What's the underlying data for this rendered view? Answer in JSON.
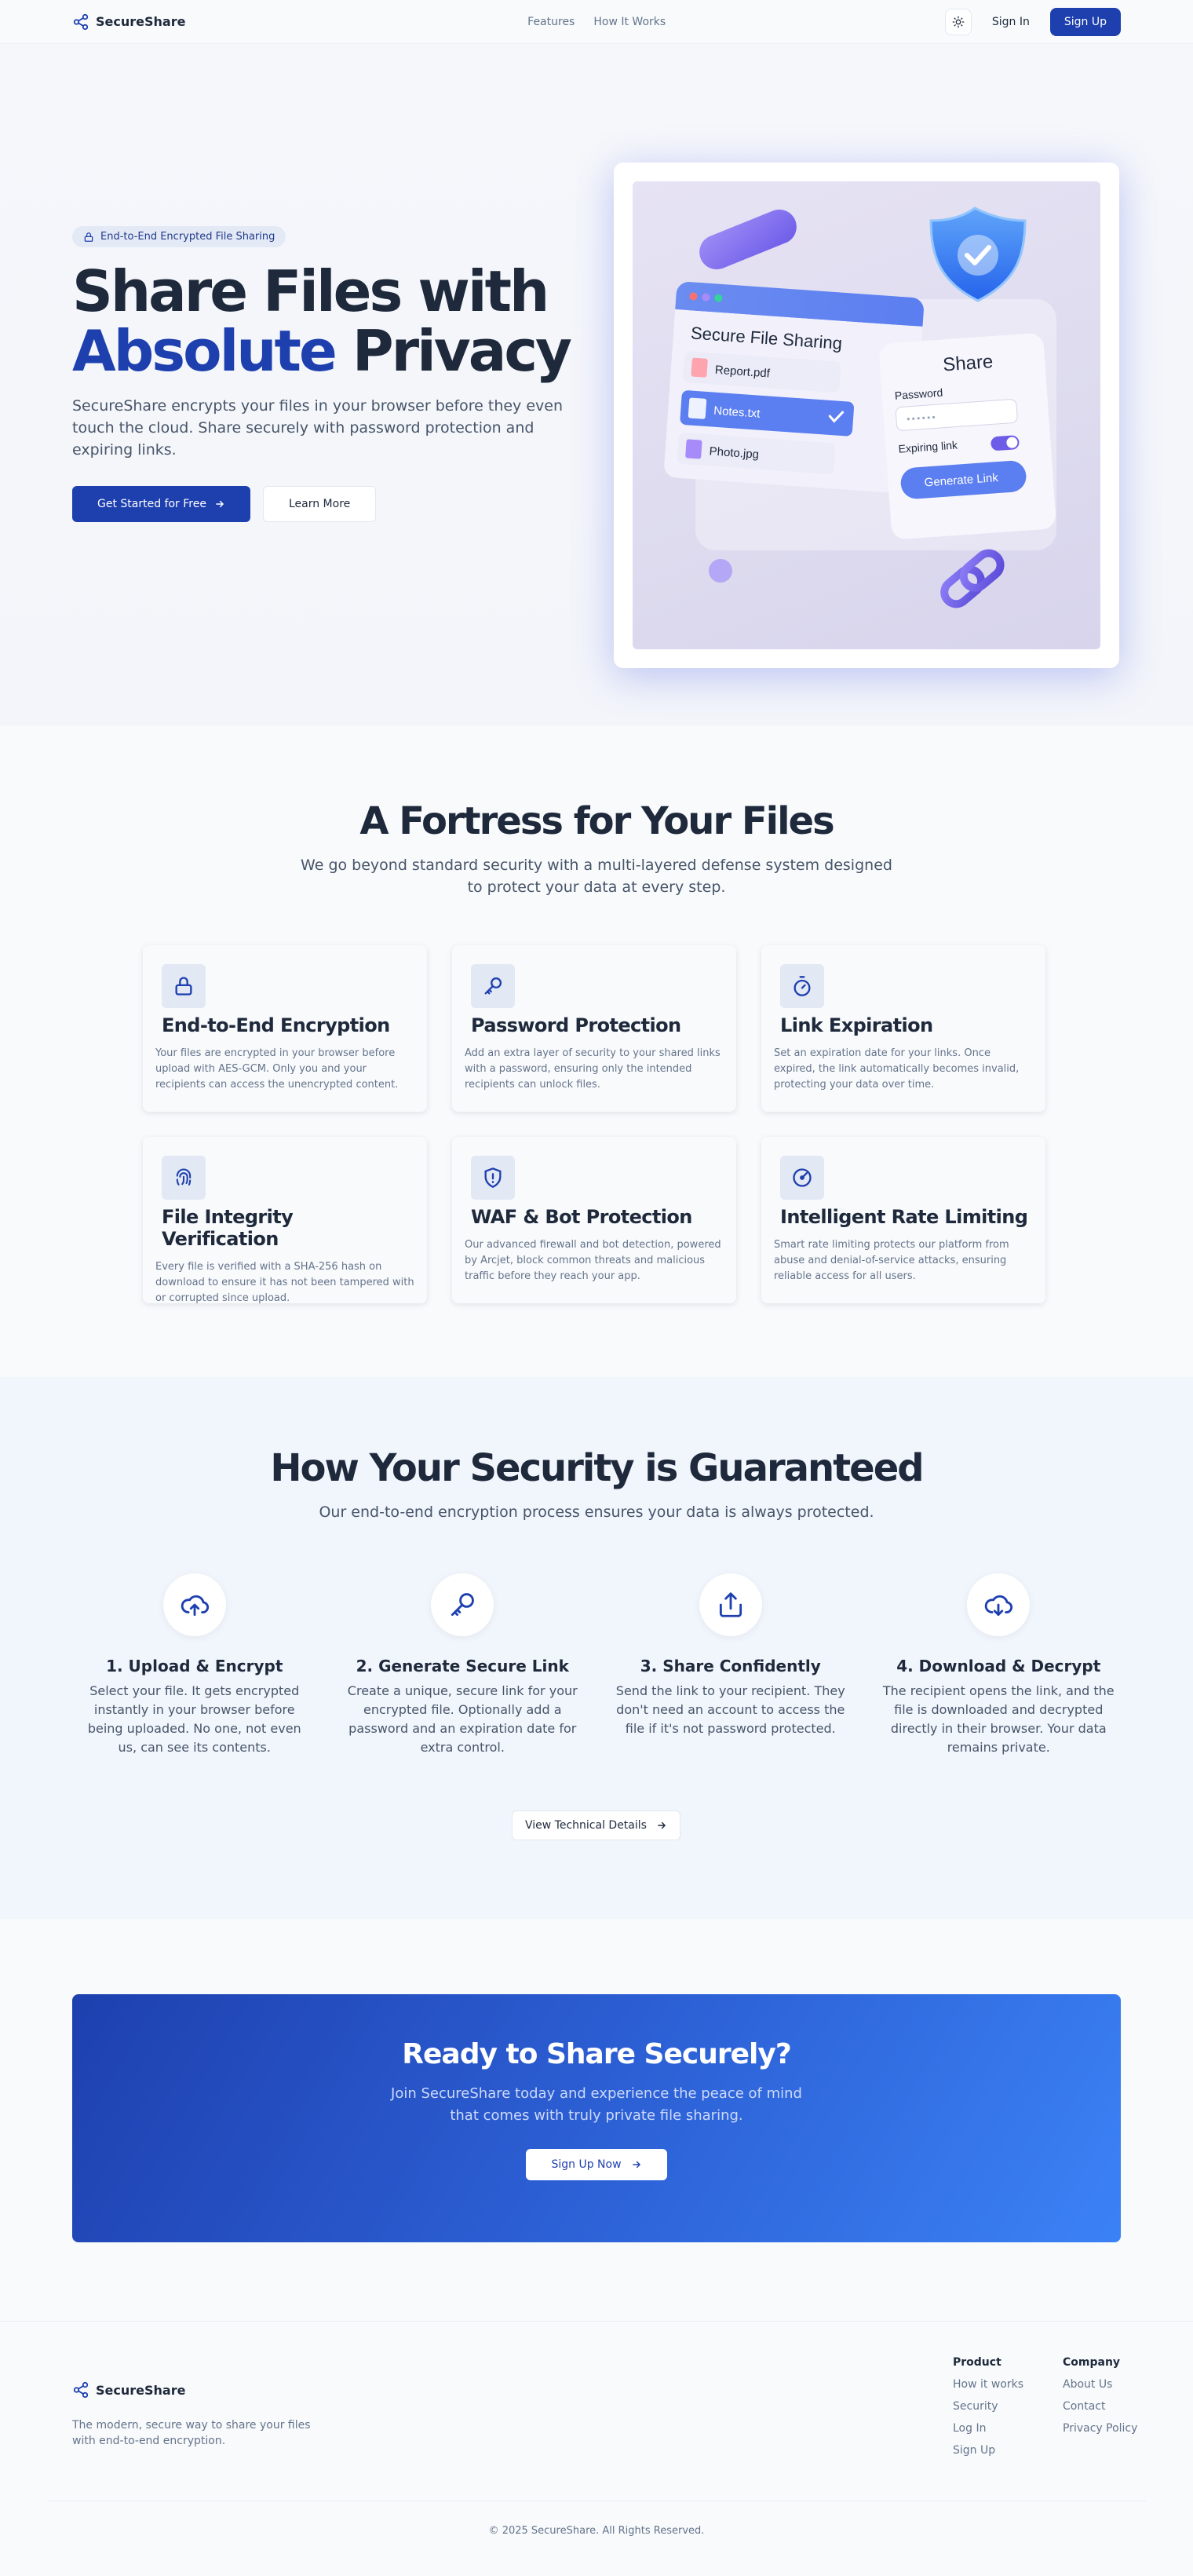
{
  "nav": {
    "brand": "SecureShare",
    "links": [
      "Features",
      "How It Works"
    ],
    "signin": "Sign In",
    "signup": "Sign Up"
  },
  "hero": {
    "badge": "End-to-End Encrypted File Sharing",
    "title_line1": "Share Files with",
    "title_accent": "Absolute",
    "title_rest": " Privacy",
    "subtitle": "SecureShare encrypts your files in your browser before they even touch the cloud. Share securely with password protection and expiring links.",
    "cta_primary": "Get Started for Free",
    "cta_secondary": "Learn More",
    "illustration": {
      "window_title": "Secure File Sharing",
      "files": [
        "Report.pdf",
        "Notes.txt",
        "Photo.jpg"
      ],
      "panel_title": "Share",
      "password_label": "Password",
      "password_dots": "••••••",
      "expiring_label": "Expiring link",
      "generate_label": "Generate Link"
    }
  },
  "features": {
    "title": "A Fortress for Your Files",
    "subtitle": "We go beyond standard security with a multi-layered defense system designed to protect your data at every step.",
    "items": [
      {
        "icon": "lock-icon",
        "title": "End-to-End Encryption",
        "text": "Your files are encrypted in your browser before upload with AES-GCM. Only you and your recipients can access the unencrypted content."
      },
      {
        "icon": "key-icon",
        "title": "Password Protection",
        "text": "Add an extra layer of security to your shared links with a password, ensuring only the intended recipients can unlock files."
      },
      {
        "icon": "timer-icon",
        "title": "Link Expiration",
        "text": "Set an expiration date for your links. Once expired, the link automatically becomes invalid, protecting your data over time."
      },
      {
        "icon": "fingerprint-icon",
        "title": "File Integrity Verification",
        "text": "Every file is verified with a SHA-256 hash on download to ensure it has not been tampered with or corrupted since upload."
      },
      {
        "icon": "shield-alert-icon",
        "title": "WAF & Bot Protection",
        "text": "Our advanced firewall and bot detection, powered by Arcjet, block common threats and malicious traffic before they reach your app."
      },
      {
        "icon": "gauge-icon",
        "title": "Intelligent Rate Limiting",
        "text": "Smart rate limiting protects our platform from abuse and denial-of-service attacks, ensuring reliable access for all users."
      }
    ]
  },
  "how": {
    "title": "How Your Security is Guaranteed",
    "subtitle": "Our end-to-end encryption process ensures your data is always protected.",
    "steps": [
      {
        "icon": "cloud-upload-icon",
        "title": "1. Upload & Encrypt",
        "text": "Select your file. It gets encrypted instantly in your browser before being uploaded. No one, not even us, can see its contents."
      },
      {
        "icon": "key-icon",
        "title": "2. Generate Secure Link",
        "text": "Create a unique, secure link for your encrypted file. Optionally add a password and an expiration date for extra control."
      },
      {
        "icon": "share-icon",
        "title": "3. Share Confidently",
        "text": "Send the link to your recipient. They don't need an account to access the file if it's not password protected."
      },
      {
        "icon": "cloud-download-icon",
        "title": "4. Download & Decrypt",
        "text": "The recipient opens the link, and the file is downloaded and decrypted directly in their browser. Your data remains private."
      }
    ],
    "tech_button": "View Technical Details"
  },
  "cta": {
    "title": "Ready to Share Securely?",
    "text": "Join SecureShare today and experience the peace of mind that comes with truly private file sharing.",
    "button": "Sign Up Now"
  },
  "footer": {
    "brand": "SecureShare",
    "description": "The modern, secure way to share your files with end-to-end encryption.",
    "product_title": "Product",
    "product_links": [
      "How it works",
      "Security",
      "Log In",
      "Sign Up"
    ],
    "company_title": "Company",
    "company_links": [
      "About Us",
      "Contact",
      "Privacy Policy"
    ],
    "copyright": "© 2025 SecureShare. All Rights Reserved."
  },
  "colors": {
    "primary": "#1e40af",
    "text": "#1e293b",
    "muted": "#64748b",
    "cta_gradient_end": "#3b82f6"
  }
}
